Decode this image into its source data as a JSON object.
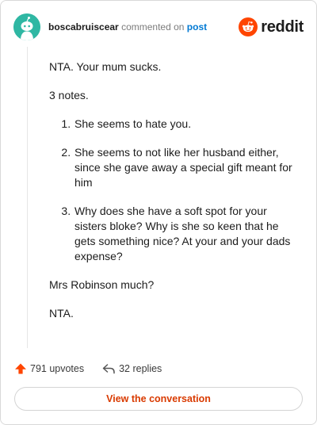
{
  "header": {
    "username": "boscabruiscear",
    "commented_on": "commented on",
    "post_link": "post",
    "brand": "reddit"
  },
  "comment": {
    "paragraphs_before": [
      "NTA. Your mum sucks.",
      "3 notes."
    ],
    "list_items": [
      "She seems to hate you.",
      "She seems to not like her husband either, since she gave away a special gift meant for him",
      "Why does she have a soft spot for your sisters bloke? Why is she so keen that he gets something nice? At your and your dads expense?"
    ],
    "paragraphs_after": [
      "Mrs Robinson much?",
      "NTA."
    ]
  },
  "footer": {
    "upvotes": "791 upvotes",
    "replies": "32 replies",
    "cta": "View the conversation"
  },
  "colors": {
    "accent": "#ff4500",
    "cta_text": "#d93a00",
    "link": "#0079d3",
    "avatar_bg": "#2fb7a3"
  },
  "icons": [
    "avatar",
    "reddit-logo-icon",
    "upvote-arrow-icon",
    "reply-arrow-icon"
  ]
}
